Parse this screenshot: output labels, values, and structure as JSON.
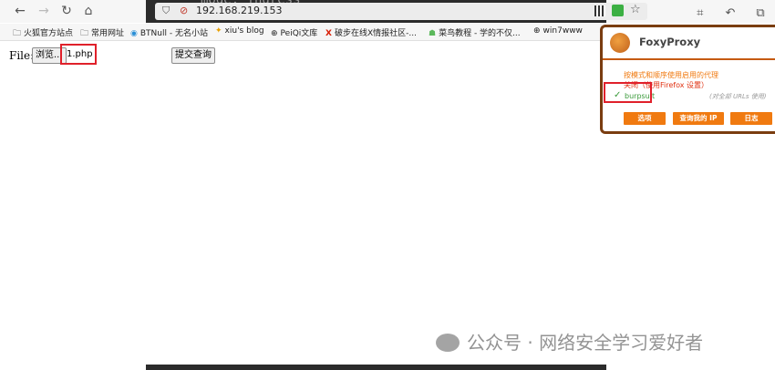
{
  "browser": {
    "url": "192.168.219.153",
    "terminal_text": "mode: ingress",
    "nav_icons": [
      "back-icon",
      "forward-icon",
      "reload-icon",
      "home-icon"
    ]
  },
  "bookmarks": [
    {
      "label": "火狐官方站点",
      "icon": "folder-icon"
    },
    {
      "label": "常用网址",
      "icon": "folder-icon"
    },
    {
      "label": "BTNull - 无名小站",
      "icon": "bt-icon"
    },
    {
      "label": "xiu's blog",
      "icon": "spark-icon"
    },
    {
      "label": "PeiQi文库",
      "icon": "globe-icon"
    },
    {
      "label": "破步在线X情报社区-...",
      "icon": "x-icon"
    },
    {
      "label": "菜鸟教程 - 学的不仅...",
      "icon": "runoob-icon"
    },
    {
      "label": "win7www",
      "icon": "globe-icon"
    }
  ],
  "form": {
    "file_label": "File:",
    "browse_label": "浏览...",
    "filename": "1.php",
    "submit_label": "提交查询"
  },
  "foxyproxy": {
    "title": "FoxyProxy",
    "mode_text": "按模式和顺序使用启用的代理",
    "off_text": "关闭（使用Firefox 设置）",
    "selected_proxy": "burpsuit",
    "note": "(对全部 URLs 使用)",
    "buttons": [
      "选项",
      "查询我的 IP",
      "日志"
    ]
  },
  "watermark": "公众号 · 网络安全学习爱好者",
  "colors": {
    "foxyproxy_border": "#7a3d10",
    "foxyproxy_accent": "#f07a10",
    "highlight_red": "#e0202a"
  }
}
